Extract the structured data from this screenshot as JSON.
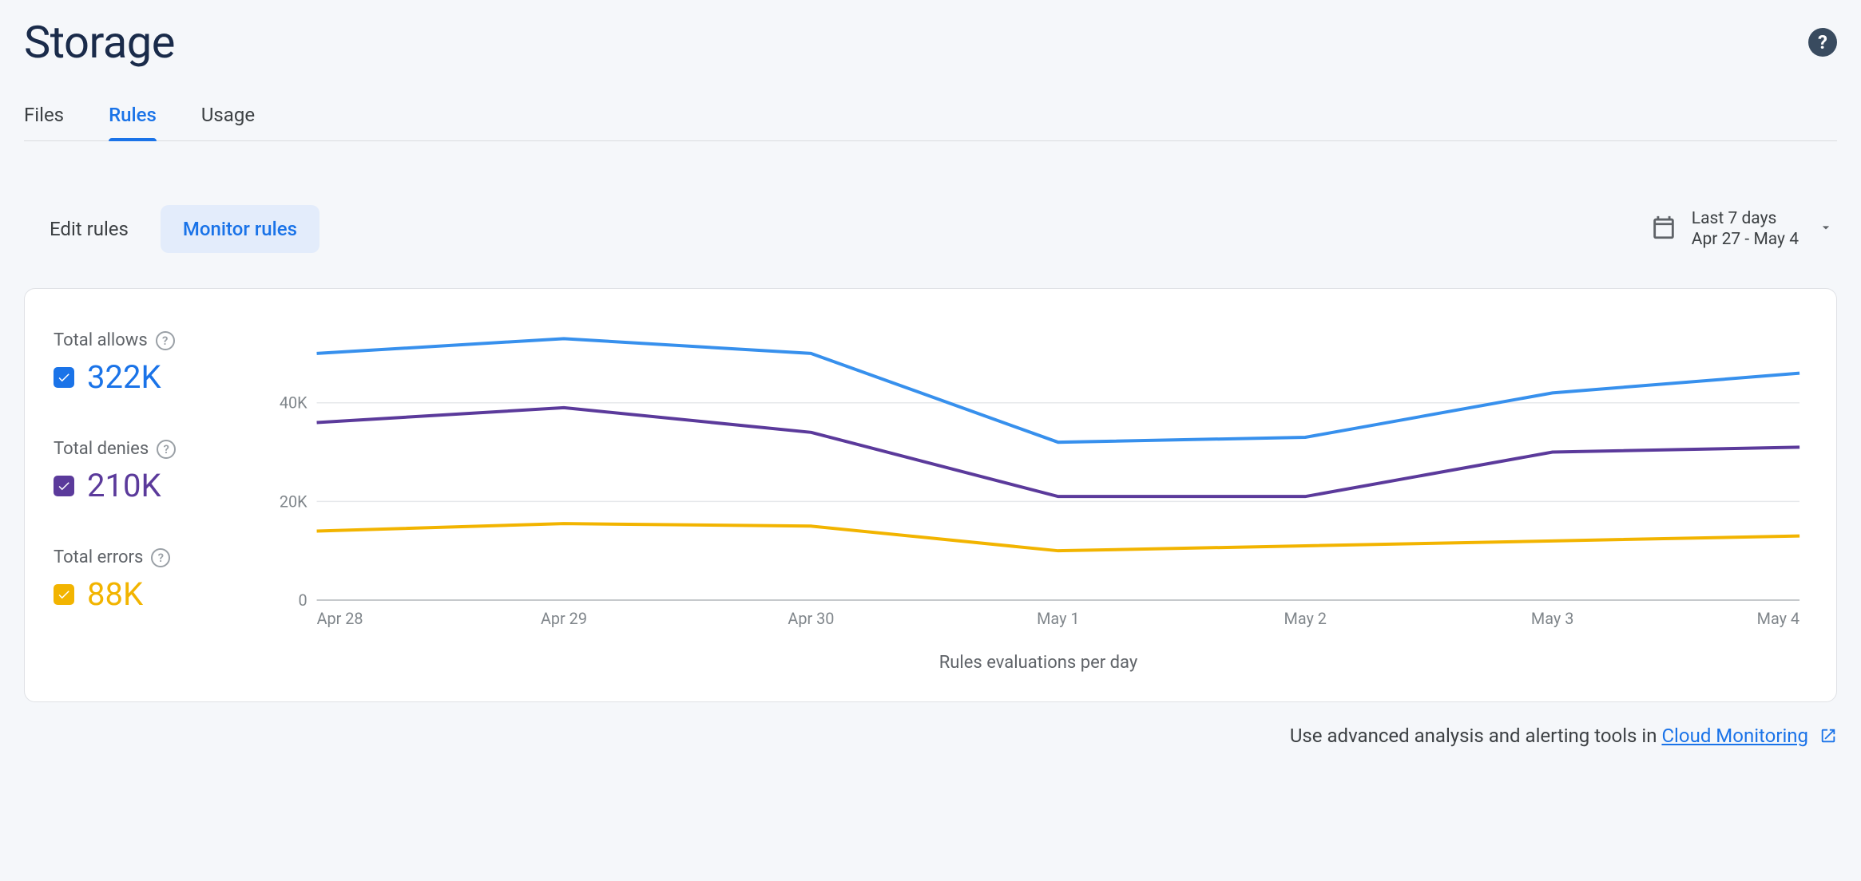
{
  "page_title": "Storage",
  "tabs": [
    {
      "label": "Files",
      "active": false
    },
    {
      "label": "Rules",
      "active": true
    },
    {
      "label": "Usage",
      "active": false
    }
  ],
  "subtabs": {
    "edit": "Edit rules",
    "monitor": "Monitor rules"
  },
  "daterange": {
    "label": "Last 7 days",
    "range": "Apr 27 - May 4"
  },
  "legend": {
    "allows": {
      "label": "Total allows",
      "value": "322K",
      "color": "#1a73e8"
    },
    "denies": {
      "label": "Total denies",
      "value": "210K",
      "color": "#5b3a9b"
    },
    "errors": {
      "label": "Total errors",
      "value": "88K",
      "color": "#f2b400"
    }
  },
  "chart_data": {
    "type": "line",
    "xlabel": "Rules evaluations per day",
    "ylabel": "",
    "ylim": [
      0,
      55000
    ],
    "y_ticks": [
      0,
      20000,
      40000
    ],
    "y_tick_labels": [
      "0",
      "20K",
      "40K"
    ],
    "categories": [
      "Apr 28",
      "Apr 29",
      "Apr 30",
      "May 1",
      "May 2",
      "May 3",
      "May 4"
    ],
    "series": [
      {
        "name": "Total allows",
        "color": "#3790ed",
        "values": [
          50000,
          53000,
          50000,
          32000,
          33000,
          42000,
          46000
        ]
      },
      {
        "name": "Total denies",
        "color": "#5b3a9b",
        "values": [
          36000,
          39000,
          34000,
          21000,
          21000,
          30000,
          31000
        ]
      },
      {
        "name": "Total errors",
        "color": "#f2b400",
        "values": [
          14000,
          15500,
          15000,
          10000,
          11000,
          12000,
          13000
        ]
      }
    ]
  },
  "footer": {
    "prefix": "Use advanced analysis and alerting tools in ",
    "link": "Cloud Monitoring"
  }
}
